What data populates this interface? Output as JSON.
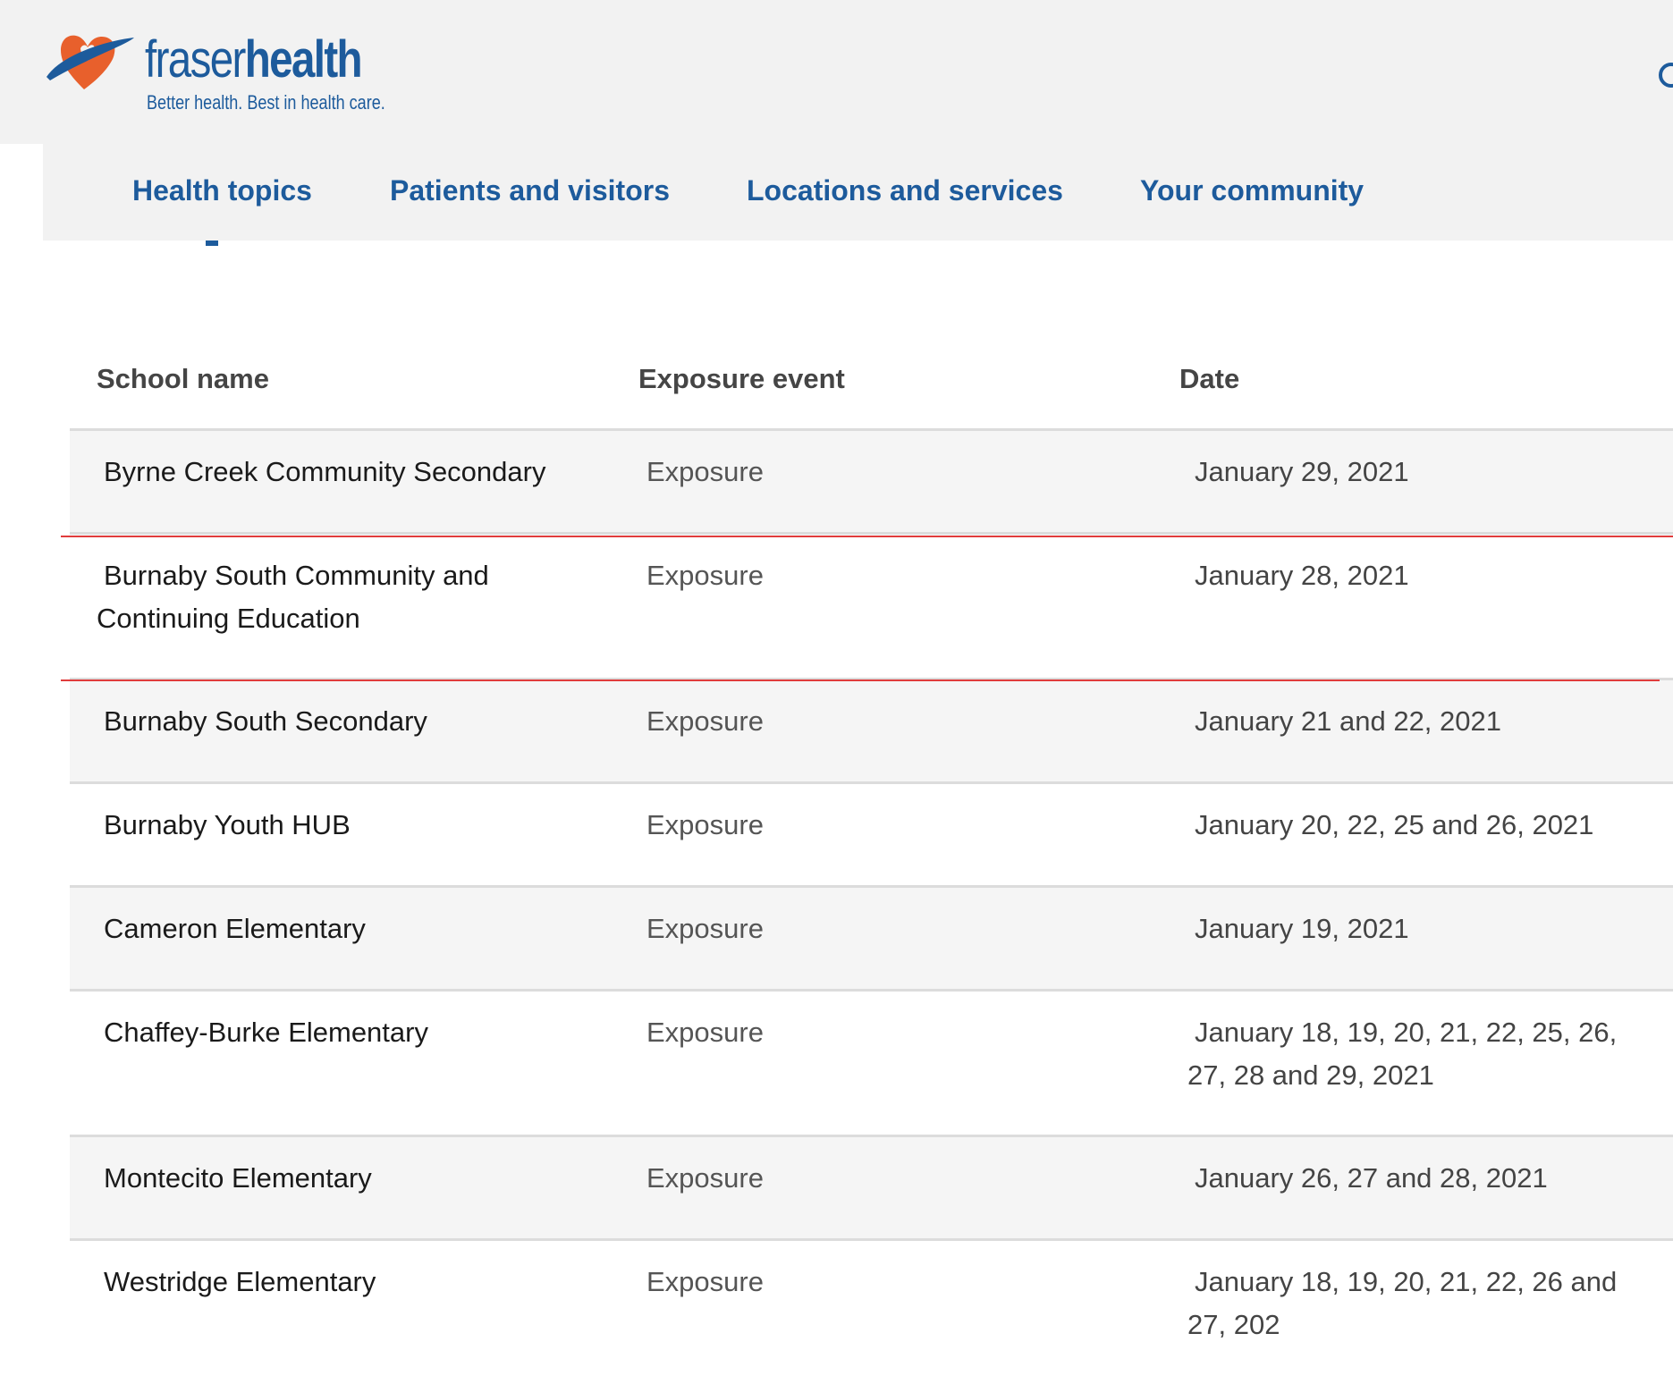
{
  "header": {
    "logo_word_light": "fraser",
    "logo_word_bold": "health",
    "logo_tagline": "Better health. Best in health care.",
    "brand_color": "#1d5b9c",
    "logo_accent_color": "#e8602c",
    "search_icon": "search-icon"
  },
  "nav": {
    "items": [
      {
        "label": "Health topics"
      },
      {
        "label": "Patients and visitors"
      },
      {
        "label": "Locations and services"
      },
      {
        "label": "Your community"
      }
    ]
  },
  "table": {
    "headers": {
      "school": "School name",
      "event": "Exposure event",
      "date": "Date"
    },
    "rows": [
      {
        "school": "Byrne Creek Community Secondary",
        "event": "Exposure",
        "date": "January 29, 2021"
      },
      {
        "school_line1": "Burnaby South Community and",
        "school_line2": "Continuing Education",
        "event": "Exposure",
        "date": "January 28, 2021"
      },
      {
        "school": "Burnaby South Secondary",
        "event": "Exposure",
        "date": "January 21 and 22, 2021"
      },
      {
        "school": "Burnaby Youth HUB",
        "event": "Exposure",
        "date": "January 20, 22, 25 and 26, 2021"
      },
      {
        "school": "Cameron Elementary",
        "event": "Exposure",
        "date": "January 19, 2021"
      },
      {
        "school": "Chaffey-Burke Elementary",
        "event": "Exposure",
        "date_line1": "January 18, 19, 20, 21, 22, 25, 26,",
        "date_line2": "27, 28 and 29, 2021"
      },
      {
        "school": "Montecito Elementary",
        "event": "Exposure",
        "date": "January 26, 27 and 28, 2021"
      },
      {
        "school": "Westridge Elementary",
        "event": "Exposure",
        "date_line1": "January 18, 19, 20, 21, 22, 26 and",
        "date_line2": "27, 202"
      }
    ]
  },
  "highlight_color": "#e03c3c"
}
